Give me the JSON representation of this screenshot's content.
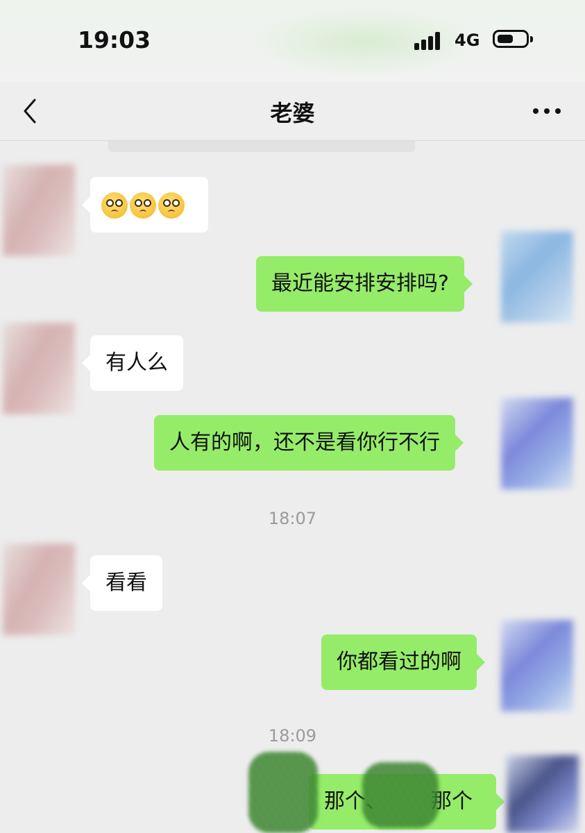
{
  "status_bar": {
    "time": "19:03",
    "network": "4G"
  },
  "nav": {
    "title": "老婆"
  },
  "messages": [
    {
      "direction": "in",
      "text": "🥺🥺🥺"
    },
    {
      "direction": "out",
      "text": "最近能安排安排吗?"
    },
    {
      "direction": "in",
      "text": "有人么"
    },
    {
      "direction": "out",
      "text": "人有的啊，还不是看你行不行"
    },
    {
      "direction": "in",
      "text": "看看"
    },
    {
      "direction": "out",
      "text": "你都看过的啊"
    },
    {
      "direction": "out",
      "text": "那个、",
      "text_b": "那个"
    }
  ],
  "timestamps": [
    "18:07",
    "18:09"
  ],
  "colors": {
    "background": "#ededed",
    "outgoing_bubble": "#95ec69",
    "incoming_bubble": "#ffffff"
  }
}
